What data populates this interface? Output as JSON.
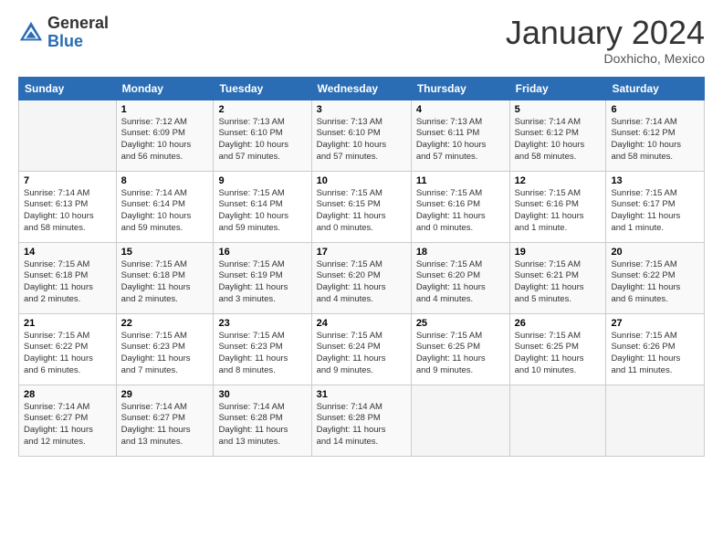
{
  "header": {
    "logo_general": "General",
    "logo_blue": "Blue",
    "month_title": "January 2024",
    "location": "Doxhicho, Mexico"
  },
  "columns": [
    "Sunday",
    "Monday",
    "Tuesday",
    "Wednesday",
    "Thursday",
    "Friday",
    "Saturday"
  ],
  "weeks": [
    [
      {
        "num": "",
        "info": ""
      },
      {
        "num": "1",
        "info": "Sunrise: 7:12 AM\nSunset: 6:09 PM\nDaylight: 10 hours\nand 56 minutes."
      },
      {
        "num": "2",
        "info": "Sunrise: 7:13 AM\nSunset: 6:10 PM\nDaylight: 10 hours\nand 57 minutes."
      },
      {
        "num": "3",
        "info": "Sunrise: 7:13 AM\nSunset: 6:10 PM\nDaylight: 10 hours\nand 57 minutes."
      },
      {
        "num": "4",
        "info": "Sunrise: 7:13 AM\nSunset: 6:11 PM\nDaylight: 10 hours\nand 57 minutes."
      },
      {
        "num": "5",
        "info": "Sunrise: 7:14 AM\nSunset: 6:12 PM\nDaylight: 10 hours\nand 58 minutes."
      },
      {
        "num": "6",
        "info": "Sunrise: 7:14 AM\nSunset: 6:12 PM\nDaylight: 10 hours\nand 58 minutes."
      }
    ],
    [
      {
        "num": "7",
        "info": "Sunrise: 7:14 AM\nSunset: 6:13 PM\nDaylight: 10 hours\nand 58 minutes."
      },
      {
        "num": "8",
        "info": "Sunrise: 7:14 AM\nSunset: 6:14 PM\nDaylight: 10 hours\nand 59 minutes."
      },
      {
        "num": "9",
        "info": "Sunrise: 7:15 AM\nSunset: 6:14 PM\nDaylight: 10 hours\nand 59 minutes."
      },
      {
        "num": "10",
        "info": "Sunrise: 7:15 AM\nSunset: 6:15 PM\nDaylight: 11 hours\nand 0 minutes."
      },
      {
        "num": "11",
        "info": "Sunrise: 7:15 AM\nSunset: 6:16 PM\nDaylight: 11 hours\nand 0 minutes."
      },
      {
        "num": "12",
        "info": "Sunrise: 7:15 AM\nSunset: 6:16 PM\nDaylight: 11 hours\nand 1 minute."
      },
      {
        "num": "13",
        "info": "Sunrise: 7:15 AM\nSunset: 6:17 PM\nDaylight: 11 hours\nand 1 minute."
      }
    ],
    [
      {
        "num": "14",
        "info": "Sunrise: 7:15 AM\nSunset: 6:18 PM\nDaylight: 11 hours\nand 2 minutes."
      },
      {
        "num": "15",
        "info": "Sunrise: 7:15 AM\nSunset: 6:18 PM\nDaylight: 11 hours\nand 2 minutes."
      },
      {
        "num": "16",
        "info": "Sunrise: 7:15 AM\nSunset: 6:19 PM\nDaylight: 11 hours\nand 3 minutes."
      },
      {
        "num": "17",
        "info": "Sunrise: 7:15 AM\nSunset: 6:20 PM\nDaylight: 11 hours\nand 4 minutes."
      },
      {
        "num": "18",
        "info": "Sunrise: 7:15 AM\nSunset: 6:20 PM\nDaylight: 11 hours\nand 4 minutes."
      },
      {
        "num": "19",
        "info": "Sunrise: 7:15 AM\nSunset: 6:21 PM\nDaylight: 11 hours\nand 5 minutes."
      },
      {
        "num": "20",
        "info": "Sunrise: 7:15 AM\nSunset: 6:22 PM\nDaylight: 11 hours\nand 6 minutes."
      }
    ],
    [
      {
        "num": "21",
        "info": "Sunrise: 7:15 AM\nSunset: 6:22 PM\nDaylight: 11 hours\nand 6 minutes."
      },
      {
        "num": "22",
        "info": "Sunrise: 7:15 AM\nSunset: 6:23 PM\nDaylight: 11 hours\nand 7 minutes."
      },
      {
        "num": "23",
        "info": "Sunrise: 7:15 AM\nSunset: 6:23 PM\nDaylight: 11 hours\nand 8 minutes."
      },
      {
        "num": "24",
        "info": "Sunrise: 7:15 AM\nSunset: 6:24 PM\nDaylight: 11 hours\nand 9 minutes."
      },
      {
        "num": "25",
        "info": "Sunrise: 7:15 AM\nSunset: 6:25 PM\nDaylight: 11 hours\nand 9 minutes."
      },
      {
        "num": "26",
        "info": "Sunrise: 7:15 AM\nSunset: 6:25 PM\nDaylight: 11 hours\nand 10 minutes."
      },
      {
        "num": "27",
        "info": "Sunrise: 7:15 AM\nSunset: 6:26 PM\nDaylight: 11 hours\nand 11 minutes."
      }
    ],
    [
      {
        "num": "28",
        "info": "Sunrise: 7:14 AM\nSunset: 6:27 PM\nDaylight: 11 hours\nand 12 minutes."
      },
      {
        "num": "29",
        "info": "Sunrise: 7:14 AM\nSunset: 6:27 PM\nDaylight: 11 hours\nand 13 minutes."
      },
      {
        "num": "30",
        "info": "Sunrise: 7:14 AM\nSunset: 6:28 PM\nDaylight: 11 hours\nand 13 minutes."
      },
      {
        "num": "31",
        "info": "Sunrise: 7:14 AM\nSunset: 6:28 PM\nDaylight: 11 hours\nand 14 minutes."
      },
      {
        "num": "",
        "info": ""
      },
      {
        "num": "",
        "info": ""
      },
      {
        "num": "",
        "info": ""
      }
    ]
  ]
}
